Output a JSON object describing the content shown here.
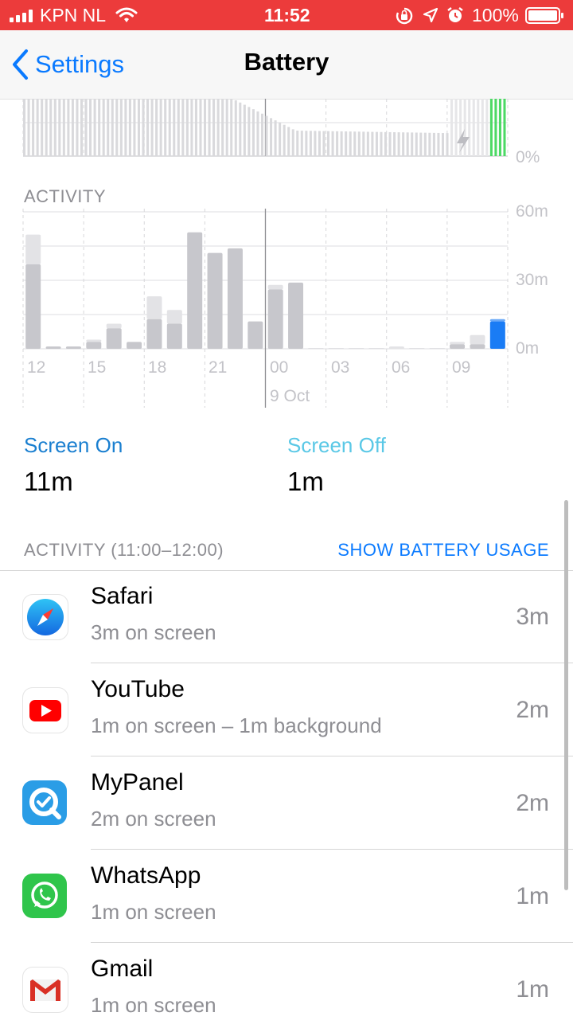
{
  "status": {
    "carrier": "KPN NL",
    "time": "11:52",
    "battery": "100%"
  },
  "nav": {
    "back_label": "Settings",
    "title": "Battery"
  },
  "battery_chart": {
    "pct_label": "0%"
  },
  "activity": {
    "label": "ACTIVITY",
    "y_ticks": [
      "60m",
      "30m",
      "0m"
    ],
    "x_ticks": [
      "12",
      "15",
      "18",
      "21",
      "00",
      "03",
      "06",
      "09"
    ],
    "date_label": "9 Oct"
  },
  "screen": {
    "on_label": "Screen On",
    "on_value": "11m",
    "off_label": "Screen Off",
    "off_value": "1m"
  },
  "list": {
    "header_left": "ACTIVITY (11:00–12:00)",
    "header_right": "SHOW BATTERY USAGE",
    "apps": [
      {
        "name": "Safari",
        "detail": "3m on screen",
        "time": "3m",
        "icon": "safari-icon"
      },
      {
        "name": "YouTube",
        "detail": "1m on screen – 1m background",
        "time": "2m",
        "icon": "youtube-icon"
      },
      {
        "name": "MyPanel",
        "detail": "2m on screen",
        "time": "2m",
        "icon": "mypanel-icon"
      },
      {
        "name": "WhatsApp",
        "detail": "1m on screen",
        "time": "1m",
        "icon": "whatsapp-icon"
      },
      {
        "name": "Gmail",
        "detail": "1m on screen",
        "time": "1m",
        "icon": "gmail-icon"
      }
    ]
  },
  "chart_data": {
    "type": "bar",
    "title": "ACTIVITY",
    "xlabel": "",
    "ylabel": "",
    "ylim": [
      0,
      60
    ],
    "unit": "minutes",
    "x_tick_labels": [
      "12",
      "15",
      "18",
      "21",
      "00",
      "03",
      "06",
      "09"
    ],
    "categories": [
      "12",
      "13",
      "14",
      "15",
      "16",
      "17",
      "18",
      "19",
      "20",
      "21",
      "22",
      "23",
      "00",
      "01",
      "02",
      "03",
      "04",
      "05",
      "06",
      "07",
      "08",
      "09",
      "10",
      "11"
    ],
    "series": [
      {
        "name": "Screen On",
        "values": [
          37,
          1,
          1,
          3,
          9,
          3,
          13,
          11,
          51,
          42,
          44,
          12,
          26,
          29,
          0,
          0,
          0,
          0,
          0,
          0,
          0,
          2,
          2,
          12
        ]
      },
      {
        "name": "Screen Off",
        "values": [
          13,
          0,
          0,
          1,
          2,
          0,
          10,
          6,
          0,
          0,
          0,
          0,
          2,
          0,
          0,
          0,
          0,
          0,
          1,
          0,
          0,
          1,
          4,
          1
        ]
      }
    ],
    "highlight_color": "#1a7cf5",
    "bar_color": "#c7c7cc",
    "light_bar_color": "#e3e3e6"
  },
  "colors": {
    "status_bg": "#ec3b3b",
    "accent": "#0a7aff",
    "screen_on": "#1a7fd0",
    "screen_off": "#5ac8e6",
    "charging": "#34c759"
  }
}
